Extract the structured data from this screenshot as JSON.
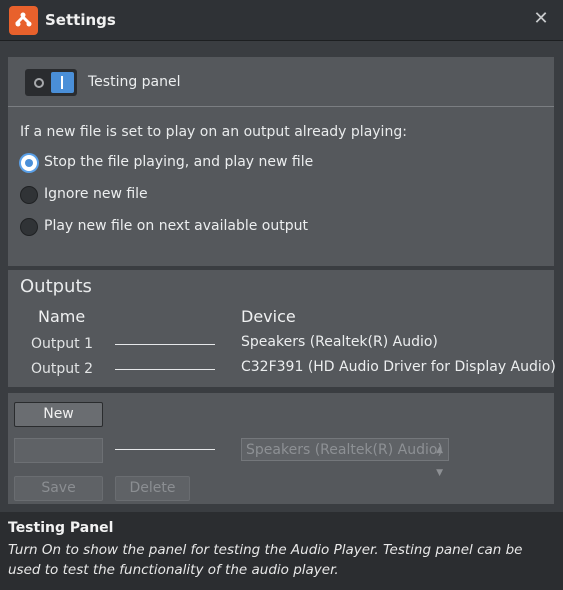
{
  "window": {
    "title": "Settings",
    "close_glyph": "✕"
  },
  "icons": {
    "app": "app-logo-icon",
    "close": "close-icon"
  },
  "testing": {
    "label": "Testing panel",
    "enabled": true
  },
  "playback": {
    "question": "If a new file is set to play on an output already playing:",
    "options": [
      {
        "label": "Stop the file playing, and play new file",
        "selected": true
      },
      {
        "label": "Ignore new file",
        "selected": false
      },
      {
        "label": "Play new file on next available output",
        "selected": false
      }
    ]
  },
  "outputs": {
    "title": "Outputs",
    "name_header": "Name",
    "device_header": "Device",
    "rows": [
      {
        "name": "Output 1",
        "device": "Speakers (Realtek(R) Audio)"
      },
      {
        "name": "Output 2",
        "device": "C32F391 (HD Audio Driver for Display Audio)"
      }
    ]
  },
  "editor": {
    "new_label": "New",
    "name_value": "",
    "device_selected": "Speakers (Realtek(R) Audio)",
    "save_label": "Save",
    "delete_label": "Delete"
  },
  "help": {
    "title": "Testing Panel",
    "text": "Turn On to show the panel for testing the Audio Player. Testing panel can be used to test the functionality of the audio player."
  },
  "colors": {
    "accent": "#4a8fd8",
    "app_icon": "#e8612c",
    "panel": "#55585c",
    "background": "#3a3d41"
  }
}
